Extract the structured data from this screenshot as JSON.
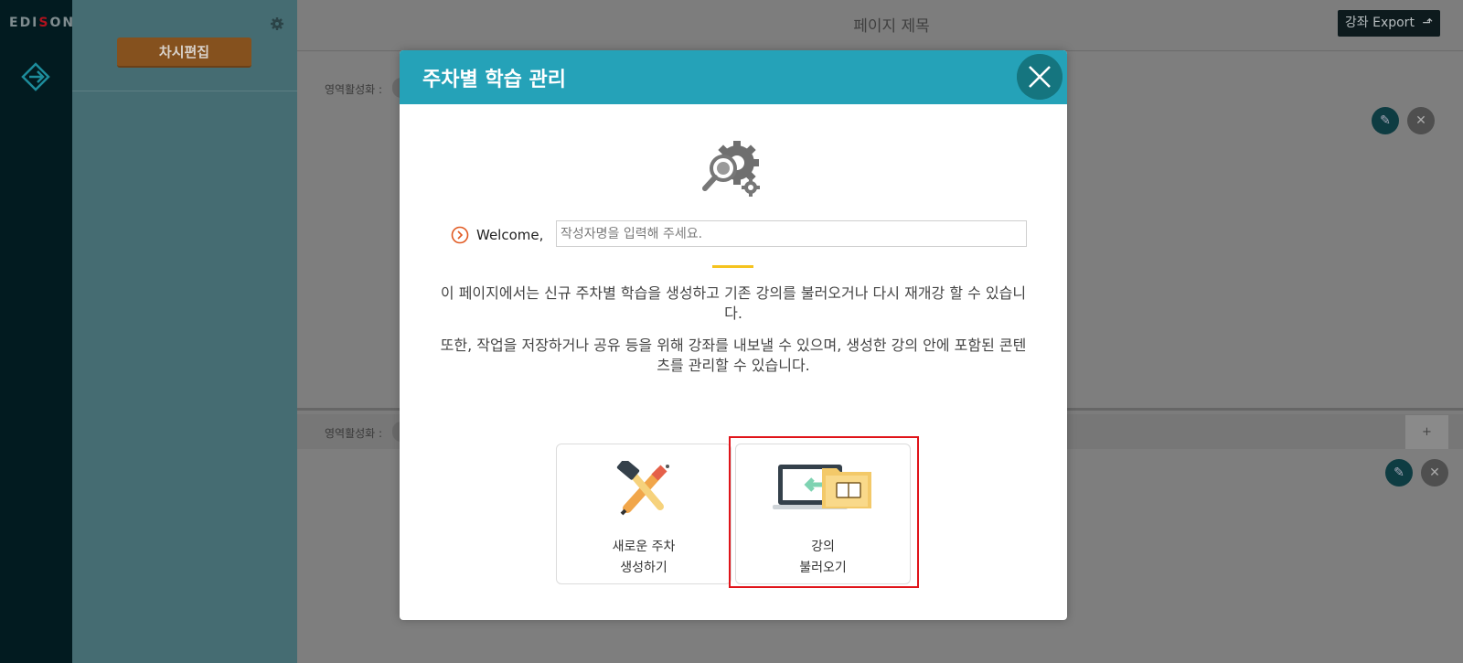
{
  "brand": {
    "logo_left": "EDI",
    "logo_s": "S",
    "logo_right": "ON"
  },
  "sidebar": {
    "edit_button_label": "차시편집"
  },
  "header": {
    "page_title": "페이지 제목",
    "export_label": "강좌 Export"
  },
  "panels": [
    {
      "area_label": "영역활성화 :"
    },
    {
      "area_label": "영역활성화 :",
      "add_tab": "+"
    }
  ],
  "modal": {
    "title": "주차별 학습 관리",
    "welcome_label": "Welcome,",
    "author_placeholder": "작성자명을 입력해 주세요.",
    "description_1": "이 페이지에서는 신규 주차별 학습을 생성하고 기존 강의를 불러오거나 다시 재개강 할 수 있습니다.",
    "description_2": "또한, 작업을 저장하거나 공유 등을 위해 강좌를 내보낼 수 있으며, 생성한 강의 안에 포함된 콘텐츠를 관리할 수 있습니다.",
    "cards": [
      {
        "line1": "새로운 주차",
        "line2": "생성하기"
      },
      {
        "line1": "강의",
        "line2": "불러오기"
      }
    ]
  },
  "colors": {
    "modal_header": "#25a2b8",
    "highlight": "#e0141a",
    "accent_divider": "#f5c31e"
  }
}
